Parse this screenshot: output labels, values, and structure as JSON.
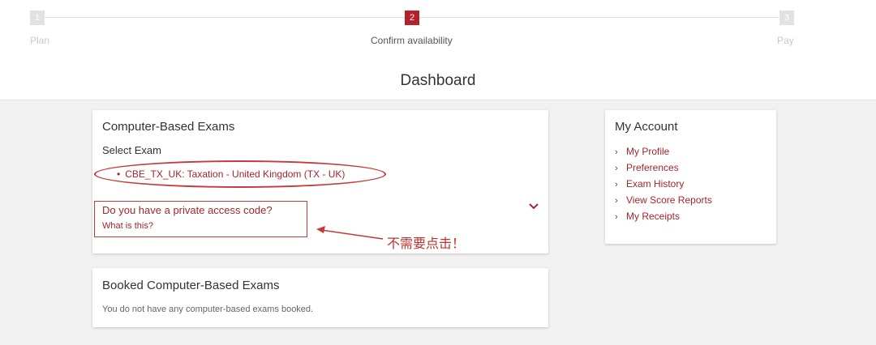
{
  "stepper": {
    "steps": [
      {
        "number": "1",
        "label": "Plan"
      },
      {
        "number": "2",
        "label": "Confirm availability"
      },
      {
        "number": "3",
        "label": "Pay"
      }
    ]
  },
  "page_title": "Dashboard",
  "cbe_card": {
    "title": "Computer-Based Exams",
    "select_label": "Select Exam",
    "exam_link": "CBE_TX_UK: Taxation - United Kingdom (TX - UK)",
    "access_question": "Do you have a private access code?",
    "what_is_this": "What is this?",
    "annotation": "不需要点击！"
  },
  "booked_card": {
    "title": "Booked Computer-Based Exams",
    "empty_text": "You do not have any computer-based exams booked."
  },
  "account": {
    "title": "My Account",
    "items": [
      {
        "label": "My Profile"
      },
      {
        "label": "Preferences"
      },
      {
        "label": "Exam History"
      },
      {
        "label": "View Score Reports"
      },
      {
        "label": "My Receipts"
      }
    ]
  },
  "colors": {
    "accent": "#b5202a",
    "link": "#a3262d",
    "annotation": "#c53a36"
  }
}
